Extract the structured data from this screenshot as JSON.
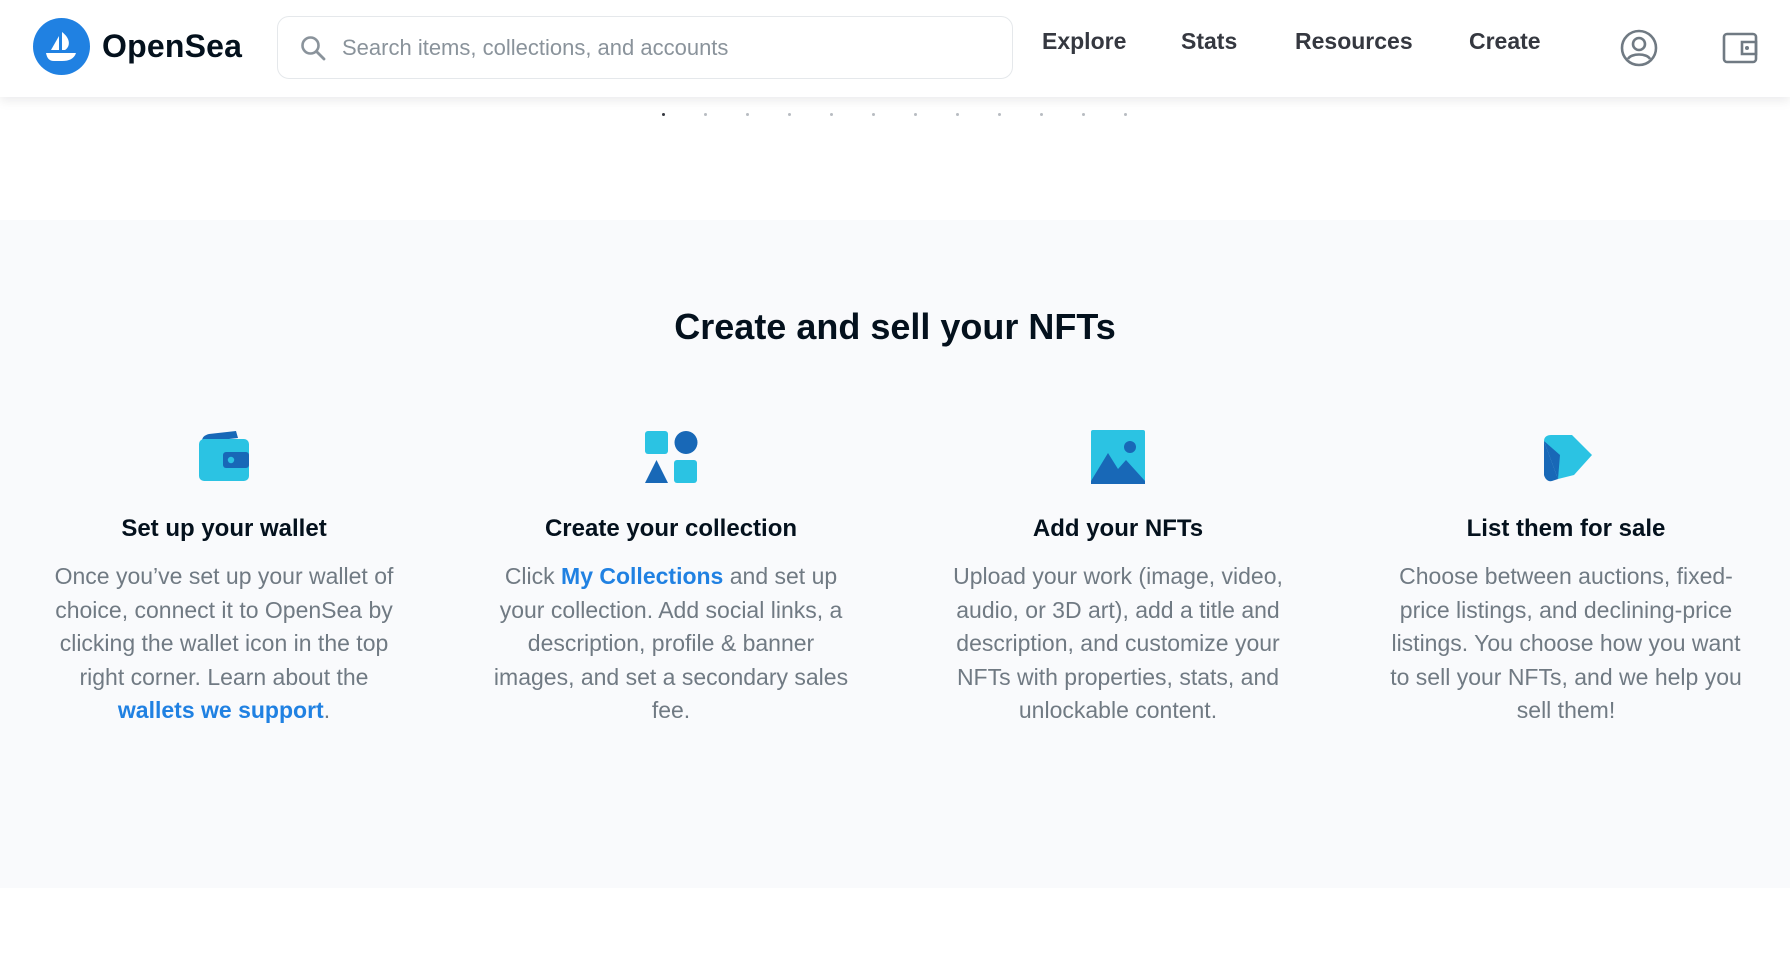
{
  "header": {
    "logo_text": "OpenSea",
    "search": {
      "placeholder": "Search items, collections, and accounts",
      "value": ""
    },
    "nav": {
      "explore": "Explore",
      "stats": "Stats",
      "resources": "Resources",
      "create": "Create"
    },
    "icons": [
      "opensea-logo-icon",
      "search-icon",
      "account-icon",
      "wallet-icon"
    ]
  },
  "carousel": {
    "dot_count": 12,
    "active_index": 0
  },
  "section": {
    "title": "Create and sell your NFTs",
    "steps": [
      {
        "icon": "wallet-icon",
        "title": "Set up your wallet",
        "text_before": "Once you’ve set up your wallet of choice, connect it to OpenSea by clicking the wallet icon in the top right corner. Learn about the ",
        "link": "wallets we support",
        "text_after": "."
      },
      {
        "icon": "collection-shapes-icon",
        "title": "Create your collection",
        "text_before": "Click ",
        "link": "My Collections",
        "text_after": " and set up your collection. Add social links, a description, profile & banner images, and set a secondary sales fee."
      },
      {
        "icon": "image-icon",
        "title": "Add your NFTs",
        "text": "Upload your work (image, video, audio, or 3D art), add a title and description, and customize your NFTs with properties, stats, and unlockable content."
      },
      {
        "icon": "price-tag-icon",
        "title": "List them for sale",
        "text": "Choose between auctions, fixed-price listings, and declining-price listings. You choose how you want to sell your NFTs, and we help you sell them!"
      }
    ]
  },
  "colors": {
    "brand": "#2081e2",
    "icon_light": "#2bc3e3",
    "icon_dark": "#1868b7",
    "text_primary": "#04111d",
    "text_secondary": "#707a83",
    "section_bg": "#f9fafc"
  }
}
